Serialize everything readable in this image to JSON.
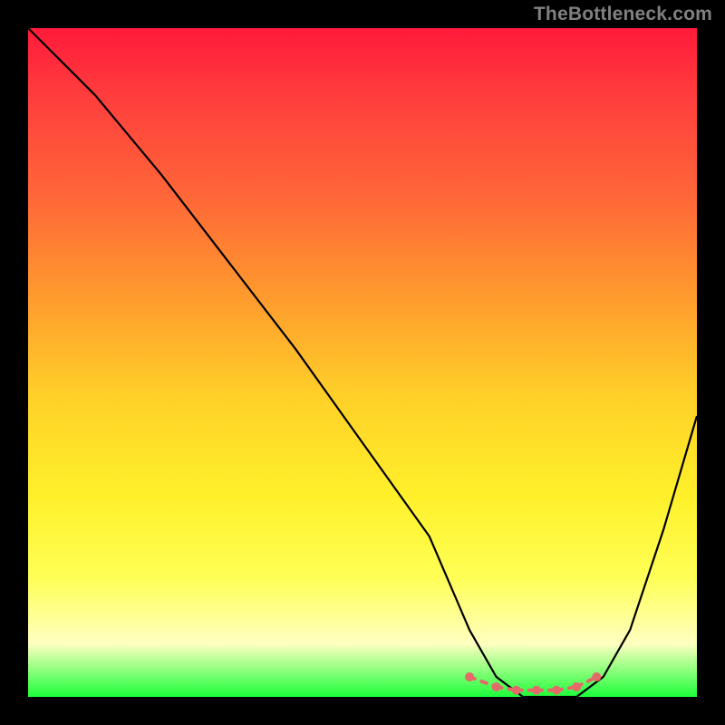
{
  "watermark": "TheBottleneck.com",
  "chart_data": {
    "type": "line",
    "title": "",
    "xlabel": "",
    "ylabel": "",
    "xlim": [
      0,
      100
    ],
    "ylim": [
      0,
      100
    ],
    "series": [
      {
        "name": "bottleneck-curve",
        "x": [
          0,
          10,
          20,
          30,
          40,
          50,
          60,
          66,
          70,
          74,
          78,
          82,
          86,
          90,
          95,
          100
        ],
        "y": [
          100,
          90,
          78,
          65,
          52,
          38,
          24,
          10,
          3,
          0,
          0,
          0,
          3,
          10,
          25,
          42
        ]
      }
    ],
    "highlight": {
      "name": "optimal-range",
      "x": [
        66,
        70,
        73,
        76,
        79,
        82,
        85
      ],
      "y": [
        3,
        1.5,
        1,
        1,
        1,
        1.5,
        3
      ]
    },
    "colors": {
      "curve": "#000000",
      "highlight": "#e46a6a"
    }
  }
}
